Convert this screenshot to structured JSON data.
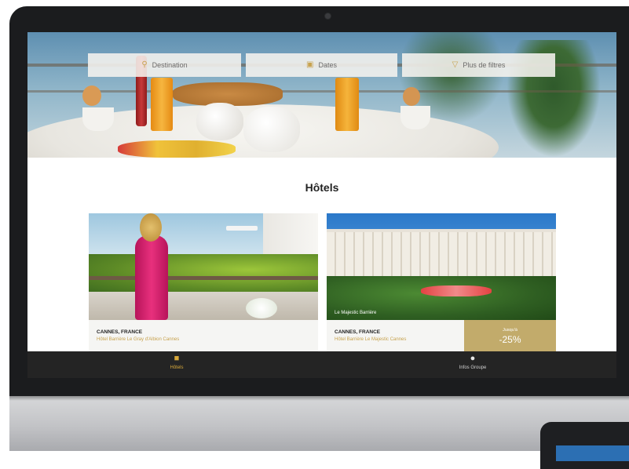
{
  "search": {
    "destination": {
      "label": "Destination",
      "icon": "search-icon"
    },
    "dates": {
      "label": "Dates",
      "icon": "calendar-icon"
    },
    "filters": {
      "label": "Plus de filtres",
      "icon": "filter-icon"
    }
  },
  "section_title": "Hôtels",
  "cards": [
    {
      "city": "CANNES, FRANCE",
      "hotel": "Hôtel Barrière Le Gray d'Albion Cannes"
    },
    {
      "city": "CANNES, FRANCE",
      "hotel": "Hôtel Barrière Le Majestic Cannes",
      "photo_caption": "Le Majestic Barrière",
      "discount_label": "Jusqu'à",
      "discount_value": "-25%"
    }
  ],
  "nav": {
    "hotels": {
      "label": "Hôtels",
      "icon": "hotel-icon"
    },
    "infos": {
      "label": "Infos Groupe",
      "icon": "info-icon"
    }
  },
  "colors": {
    "accent": "#c7a24e",
    "discount_bg": "#c2ab6b",
    "nav_bg": "#242424",
    "bezel": "#1b1c1e"
  }
}
